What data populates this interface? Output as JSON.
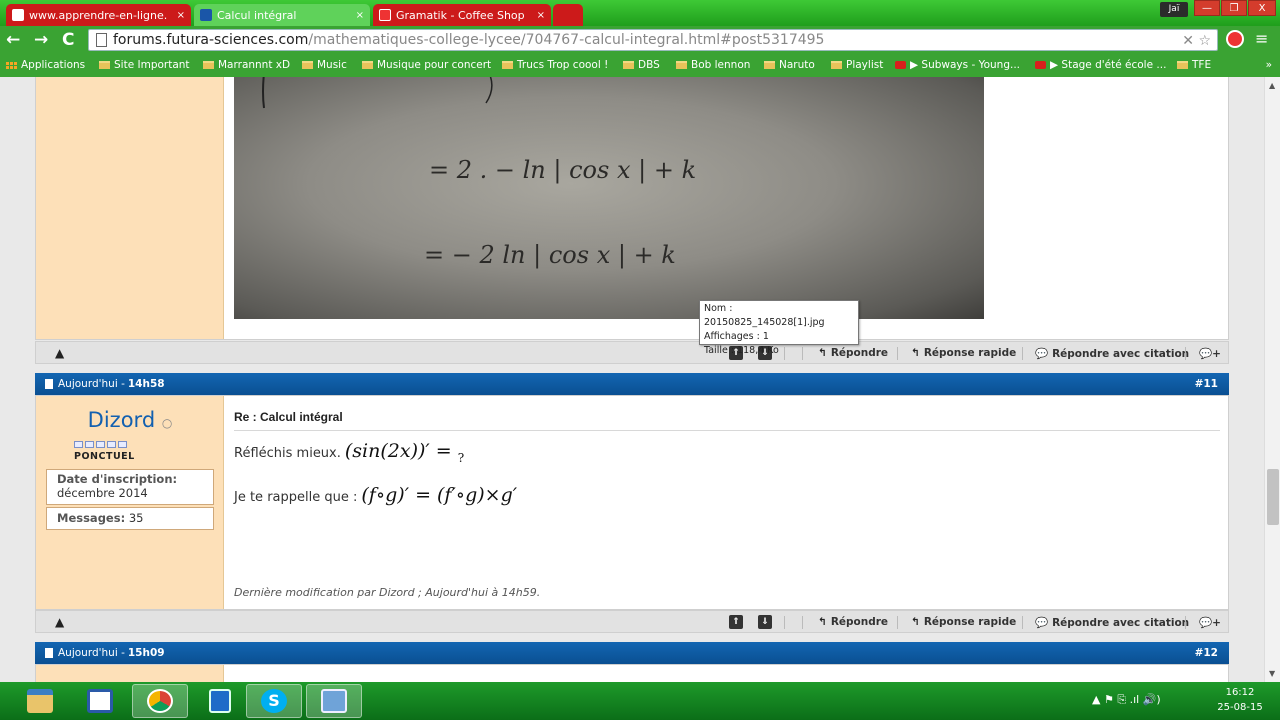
{
  "browser": {
    "tabs": [
      {
        "label": "www.apprendre-en-ligne.",
        "close": "×"
      },
      {
        "label": "Calcul intégral",
        "close": "×"
      },
      {
        "label": "Gramatik - Coffee Shop",
        "close": "×"
      }
    ],
    "user_chip": "Jaï",
    "window_controls": {
      "min": "—",
      "max": "❐",
      "close": "X"
    },
    "nav": {
      "back": "←",
      "forward": "→",
      "reload": "C"
    },
    "url_host": "forums.futura-sciences.com",
    "url_path": "/mathematiques-college-lycee/704767-calcul-integral.html#post5317495",
    "omni_icons": "✕ ☆",
    "menu_icon": "≡"
  },
  "bookmarks": [
    "Applications",
    "Site Important",
    "Marrannnt xD",
    "Music",
    "Musique pour concert",
    "Trucs Trop coool !",
    "DBS",
    "Bob lennon",
    "Naruto",
    "Playlist",
    "▶ Subways - Young...",
    "▶ Stage d'été école ...",
    "TFE"
  ],
  "bookmarks_more": "»",
  "photo_text": {
    "line1": "= 2 .  − ln | cos x |  + k",
    "line2": "= − 2  ln | cos x |  + k"
  },
  "attachment_tooltip": {
    "name": "Nom : 20150825_145028[1].jpg",
    "views": "Affichages : 1",
    "size": "Taille : 118,4 Ko"
  },
  "actions": {
    "warn": "▲",
    "up": "⇑",
    "down": "⇓",
    "reply": "Répondre",
    "quick_reply": "Réponse rapide",
    "reply_quote": "Répondre avec citation",
    "reply_icon": "↰",
    "quote_icon": "💬",
    "more": "💬+"
  },
  "post11": {
    "date": "Aujourd'hui -",
    "time": "14h58",
    "number": "#11",
    "username": "Dizord",
    "online_dot": "○",
    "rank": "PONCTUEL",
    "join_label": "Date d'inscription:",
    "join_value": "décembre 2014",
    "messages_label": "Messages:",
    "messages_value": "35",
    "title": "Re : Calcul intégral",
    "line1_text": "Réfléchis mieux.",
    "line1_math": "(sin(2x))′ =",
    "line1_q": "?",
    "line2_text": "Je te rappelle que :",
    "line2_math": "(f∘g)′ = (f′∘g)×g′",
    "edit_note": "Dernière modification par Dizord ; Aujourd'hui à 14h59."
  },
  "post12": {
    "date": "Aujourd'hui -",
    "time": "15h09",
    "number": "#12"
  },
  "taskbar": {
    "skype_letter": "S",
    "tray": "▲  ⚑  ⎘  .ıl  🔊)",
    "clock_time": "16:12",
    "clock_date": "25-08-15"
  }
}
